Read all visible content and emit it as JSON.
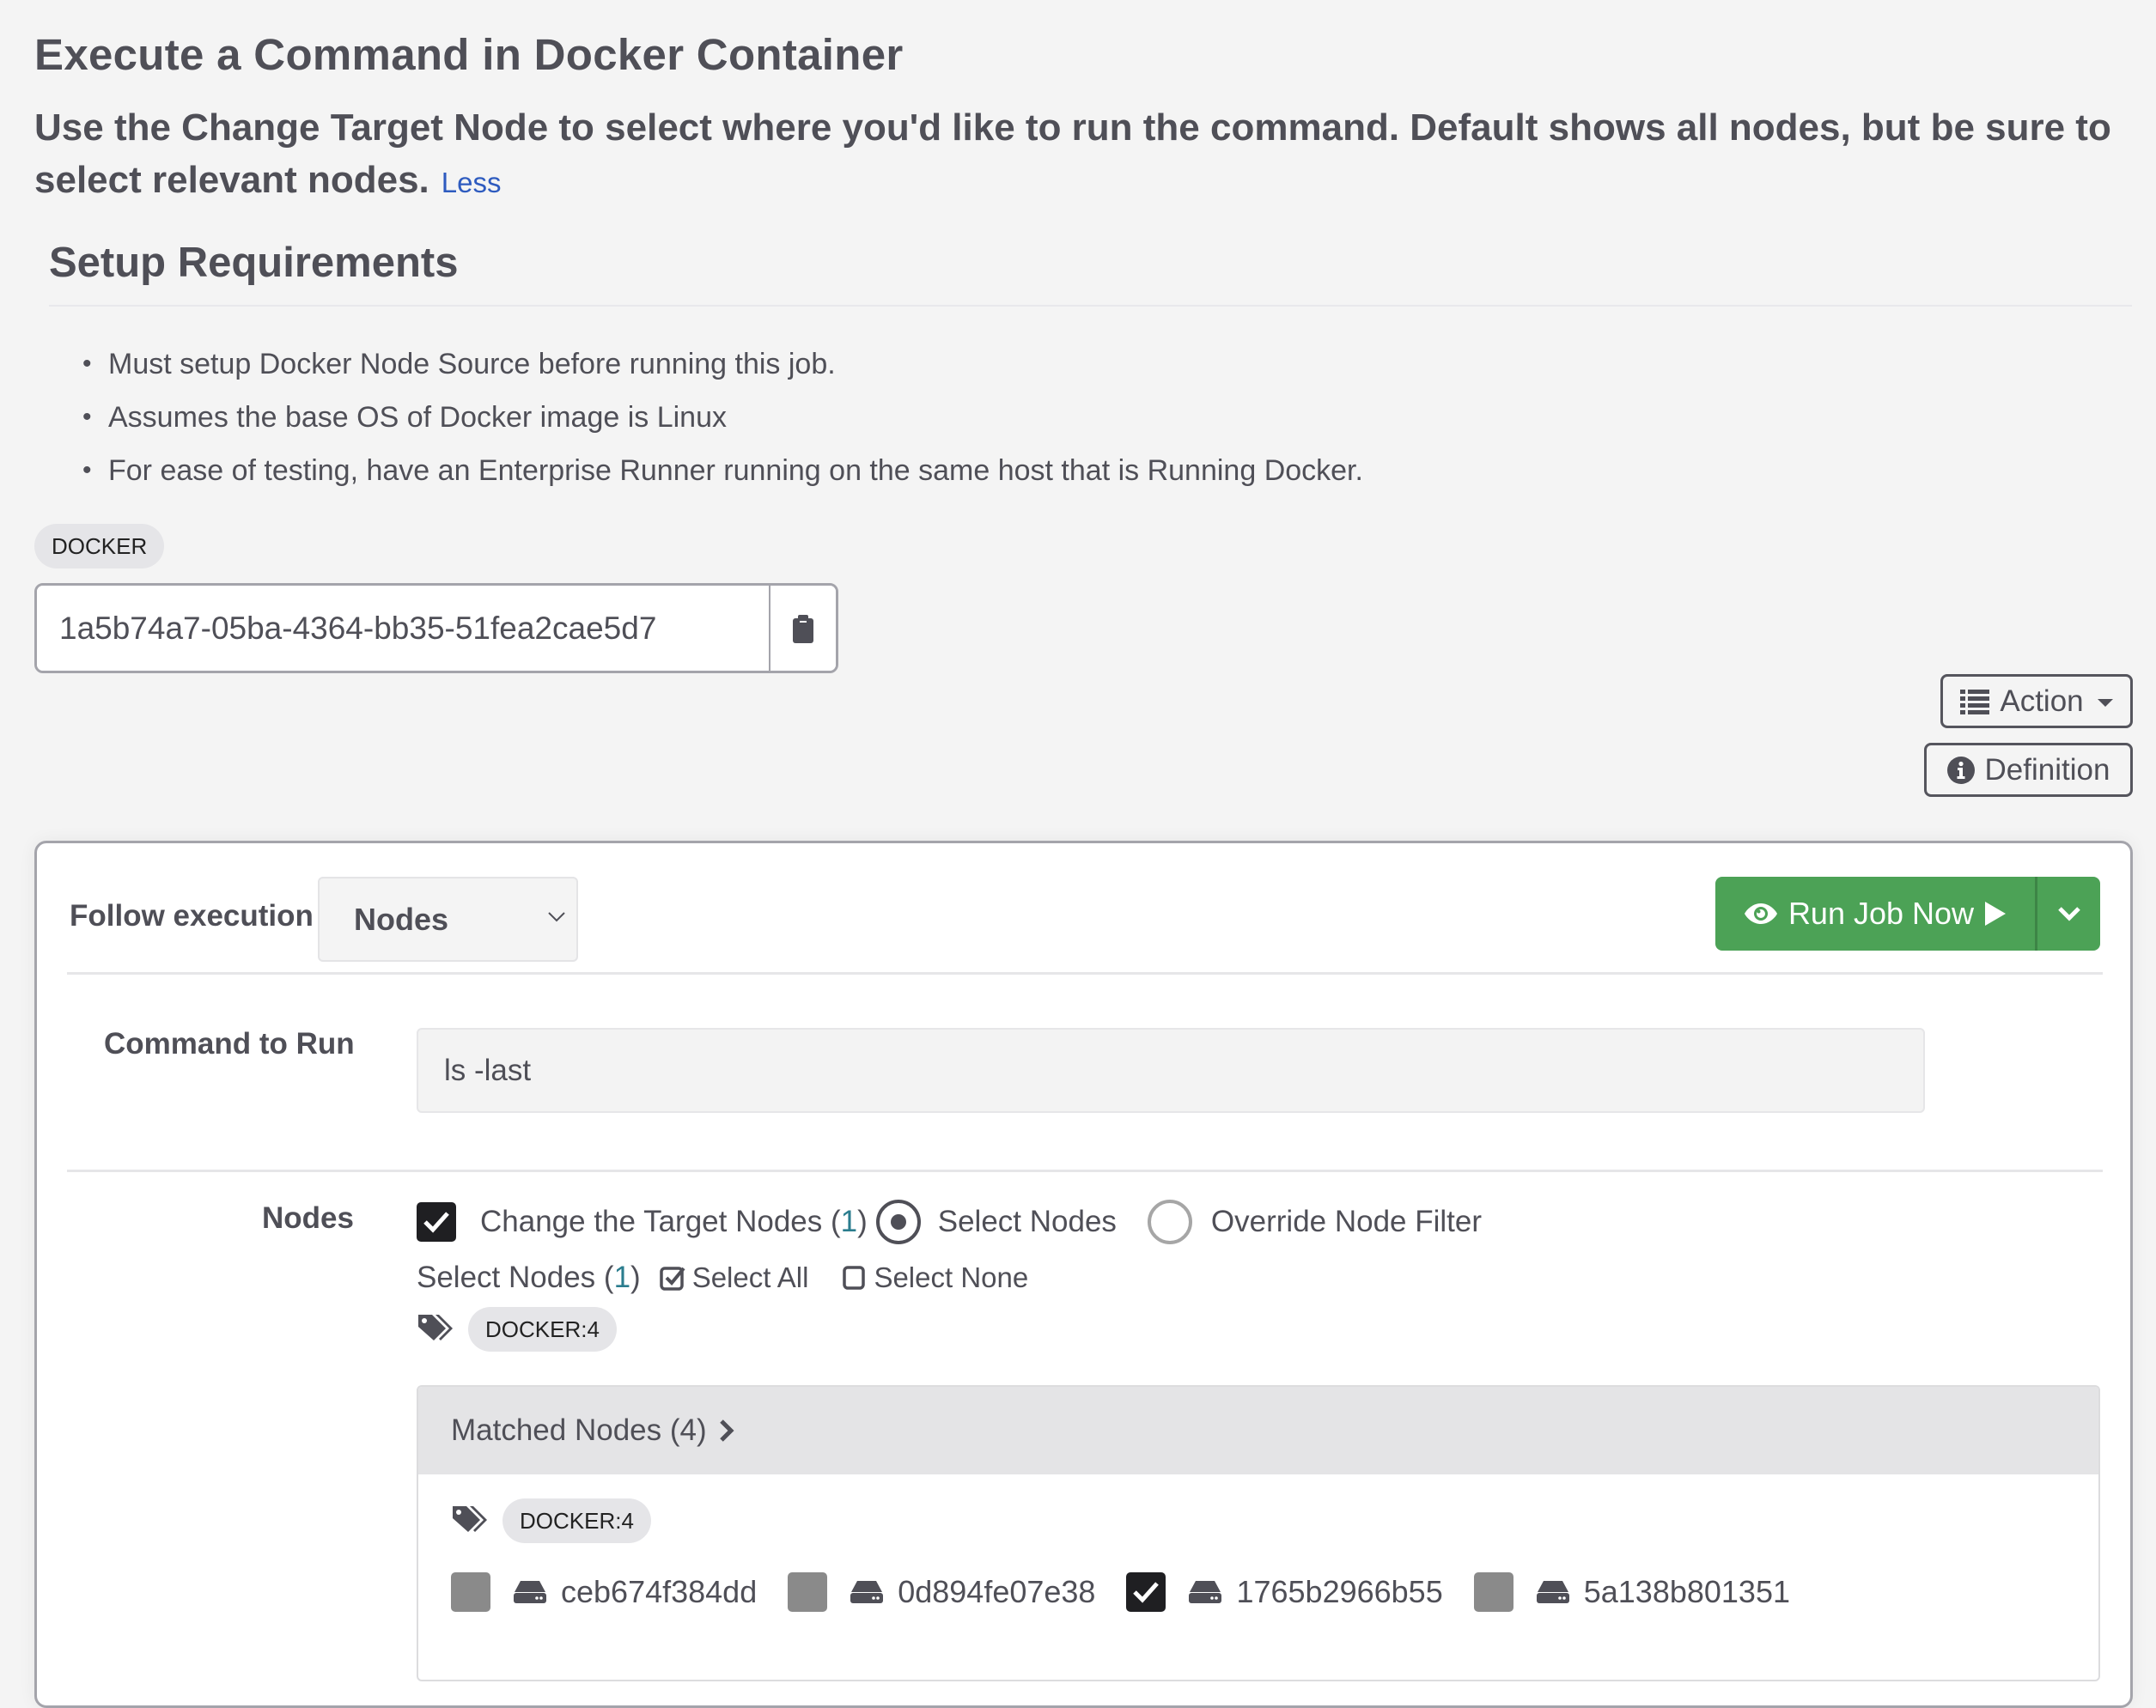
{
  "header": {
    "title": "Execute a Command in Docker Container",
    "description": "Use the Change Target Node to select where you'd like to run the command. Default shows all nodes, but be sure to select relevant nodes.",
    "less_link": "Less"
  },
  "setup": {
    "title": "Setup Requirements",
    "items": [
      "Must setup Docker Node Source before running this job.",
      "Assumes the base OS of Docker image is Linux",
      "For ease of testing, have an Enterprise Runner running on the same host that is Running Docker."
    ]
  },
  "job": {
    "tag": "DOCKER",
    "uuid": "1a5b74a7-05ba-4364-bb35-51fea2cae5d7",
    "copy_icon": "clipboard-icon"
  },
  "toolbar": {
    "action_label": "Action",
    "action_icon": "list-icon",
    "definition_label": "Definition",
    "definition_icon": "info-circle-icon"
  },
  "run_panel": {
    "follow_label": "Follow execution",
    "follow_value": "Nodes",
    "run_label": "Run Job Now",
    "run_icon": "eye-icon",
    "run_accent": "#4ca256",
    "command_label": "Command to Run",
    "command_value": "ls -last",
    "nodes_label": "Nodes",
    "change_target_label": "Change the Target Nodes (",
    "change_target_count": "1",
    "change_target_checked": true,
    "close_paren": ")",
    "select_nodes_radio": "Select Nodes",
    "override_filter_radio": "Override Node Filter",
    "selected_mode": "Select Nodes",
    "select_nodes_label": "Select Nodes (",
    "select_nodes_count": "1",
    "select_all": "Select All",
    "select_none": "Select None",
    "filter_tag": "DOCKER:4",
    "matched_title": "Matched Nodes (4)",
    "matched_tag": "DOCKER:4",
    "nodes": [
      {
        "name": "ceb674f384dd",
        "checked": false
      },
      {
        "name": "0d894fe07e38",
        "checked": false
      },
      {
        "name": "1765b2966b55",
        "checked": true
      },
      {
        "name": "5a138b801351",
        "checked": false
      }
    ]
  }
}
